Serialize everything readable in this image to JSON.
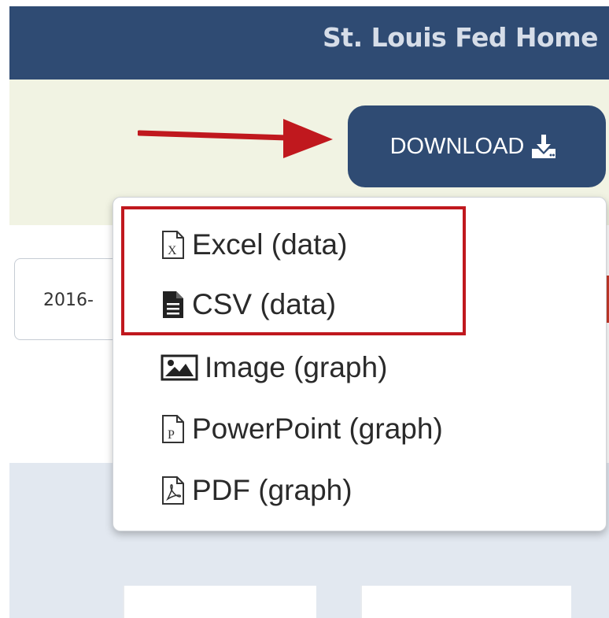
{
  "navbar": {
    "home_link": "St. Louis Fed Home"
  },
  "toolbar": {
    "download_label": "DOWNLOAD",
    "download_icon": "download-icon"
  },
  "date_field": {
    "value": "2016-"
  },
  "download_menu": {
    "items": [
      {
        "label": "Excel (data)",
        "icon": "excel-file-icon"
      },
      {
        "label": "CSV (data)",
        "icon": "csv-file-icon"
      },
      {
        "label": "Image (graph)",
        "icon": "image-icon"
      },
      {
        "label": "PowerPoint (graph)",
        "icon": "powerpoint-file-icon"
      },
      {
        "label": "PDF (graph)",
        "icon": "pdf-file-icon"
      }
    ]
  },
  "colors": {
    "navbar": "#2f4b73",
    "button": "#2f4b73",
    "toolbar": "#f1f3e3",
    "annotation_red": "#c0181e"
  }
}
